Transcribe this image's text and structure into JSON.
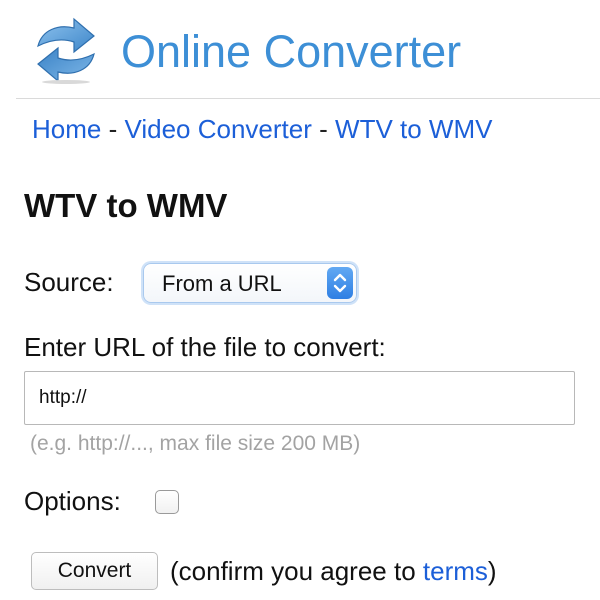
{
  "header": {
    "site_title": "Online Converter",
    "logo_icon": "refresh-arrows-icon",
    "accent_color": "#3d8fd6"
  },
  "breadcrumb": {
    "items": [
      "Home",
      "Video Converter",
      "WTV to WMV"
    ],
    "separator": "-",
    "link_color": "#1c5fd8"
  },
  "page_title": "WTV to WMV",
  "source": {
    "label": "Source:",
    "selected": "From a URL",
    "icon": "select-arrows-icon"
  },
  "url_field": {
    "label": "Enter URL of the file to convert:",
    "value": "http://",
    "hint": "(e.g. http://..., max file size 200 MB)"
  },
  "options": {
    "label": "Options:",
    "checked": false
  },
  "convert": {
    "button_label": "Convert",
    "note_prefix": "(confirm you agree to ",
    "terms_link": "terms",
    "note_suffix": ")"
  }
}
